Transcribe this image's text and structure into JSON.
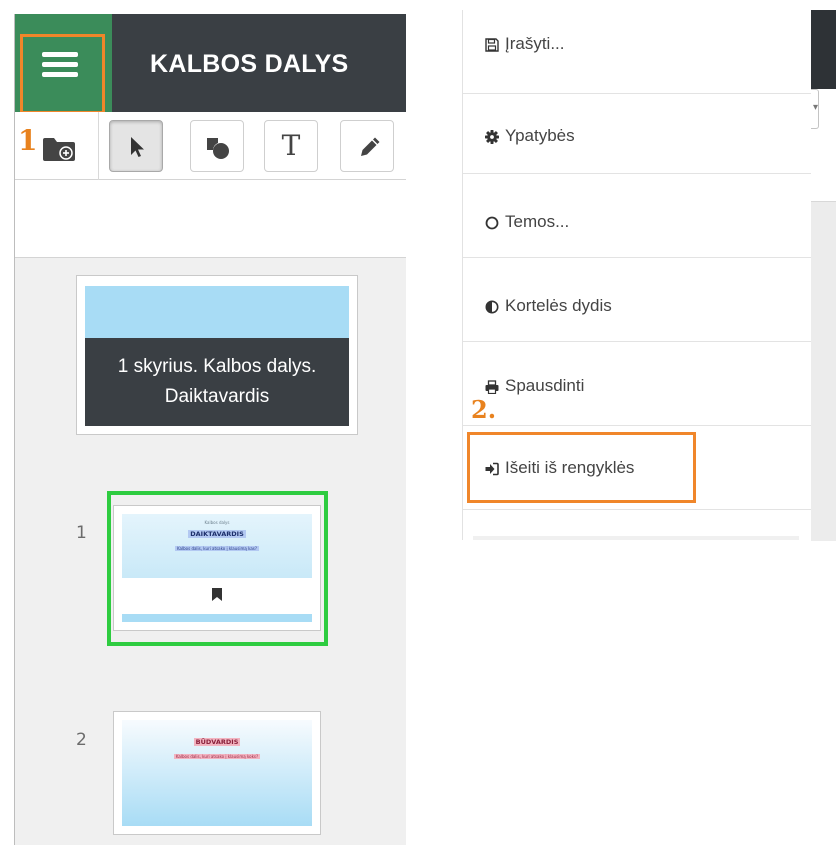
{
  "editor": {
    "title": "KALBOS DALYS",
    "menu_button": "hamburger-menu",
    "annotation_step_1": "1",
    "toolbar": {
      "tools": [
        {
          "name": "add-folder",
          "icon": "folder-plus-icon"
        },
        {
          "name": "select",
          "icon": "pointer-icon",
          "active": true
        },
        {
          "name": "shapes",
          "icon": "shapes-icon"
        },
        {
          "name": "text",
          "label": "T"
        },
        {
          "name": "draw",
          "icon": "pencil-icon"
        }
      ]
    },
    "chapter_card": {
      "title": "1 skyrius. Kalbos dalys. Daiktavardis"
    },
    "slides": [
      {
        "number": "1",
        "subtitle": "Kalbos dalys",
        "title": "DAIKTAVARDIS",
        "text": "Kalbos dalis, kuri atsako į klausimą kas?",
        "highlight": "#b3c9f2",
        "selected": true
      },
      {
        "number": "2",
        "title": "BŪDVARDIS",
        "text": "Kalbos dalis, kuri atsako į klausimą koks?",
        "highlight": "#f2b3c0",
        "selected": false
      }
    ]
  },
  "menu": {
    "items": [
      {
        "label": "Įrašyti...",
        "icon": "save-icon"
      },
      {
        "label": "Ypatybės",
        "icon": "gear-icon"
      },
      {
        "label": "Temos...",
        "icon": "circle-icon"
      },
      {
        "label": "Kortelės dydis",
        "icon": "half-circle-icon"
      },
      {
        "label": "Spausdinti",
        "icon": "print-icon"
      },
      {
        "label": "Išeiti iš rengyklės",
        "icon": "sign-out-icon"
      }
    ],
    "annotation_step_2": "2."
  },
  "colors": {
    "accent_orange": "#f0862a",
    "menu_tile_green": "#3b8c5a",
    "selection_green": "#2ecc40",
    "header_dark": "#3a3f44",
    "slide_sky": "#a8dcf5"
  }
}
